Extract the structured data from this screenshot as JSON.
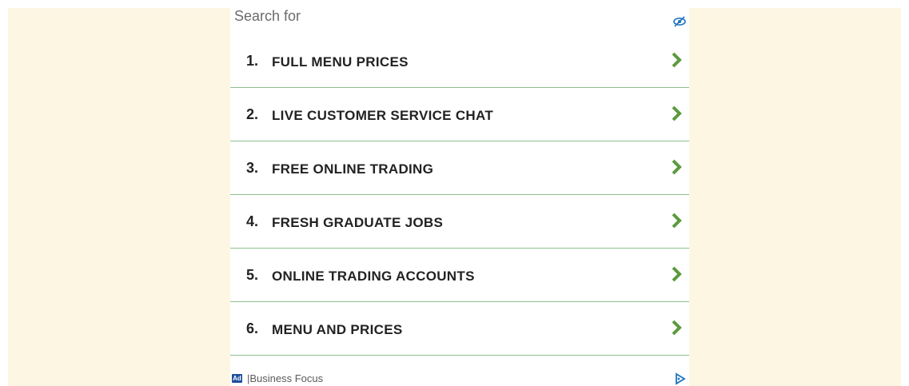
{
  "header": {
    "search_label": "Search for",
    "hide_icon": "eye-hide-icon"
  },
  "items": [
    {
      "number": "1.",
      "label": "FULL MENU PRICES"
    },
    {
      "number": "2.",
      "label": "LIVE CUSTOMER SERVICE CHAT"
    },
    {
      "number": "3.",
      "label": "FREE ONLINE TRADING"
    },
    {
      "number": "4.",
      "label": "FRESH GRADUATE JOBS"
    },
    {
      "number": "5.",
      "label": "ONLINE TRADING ACCOUNTS"
    },
    {
      "number": "6.",
      "label": "MENU AND PRICES"
    }
  ],
  "footer": {
    "ad_badge": "Ad",
    "sponsor": "|Business Focus"
  },
  "colors": {
    "background": "#fdf6e3",
    "divider": "#8fbf8f",
    "chevron": "#5c9a3e",
    "icon_blue": "#1e73be"
  }
}
